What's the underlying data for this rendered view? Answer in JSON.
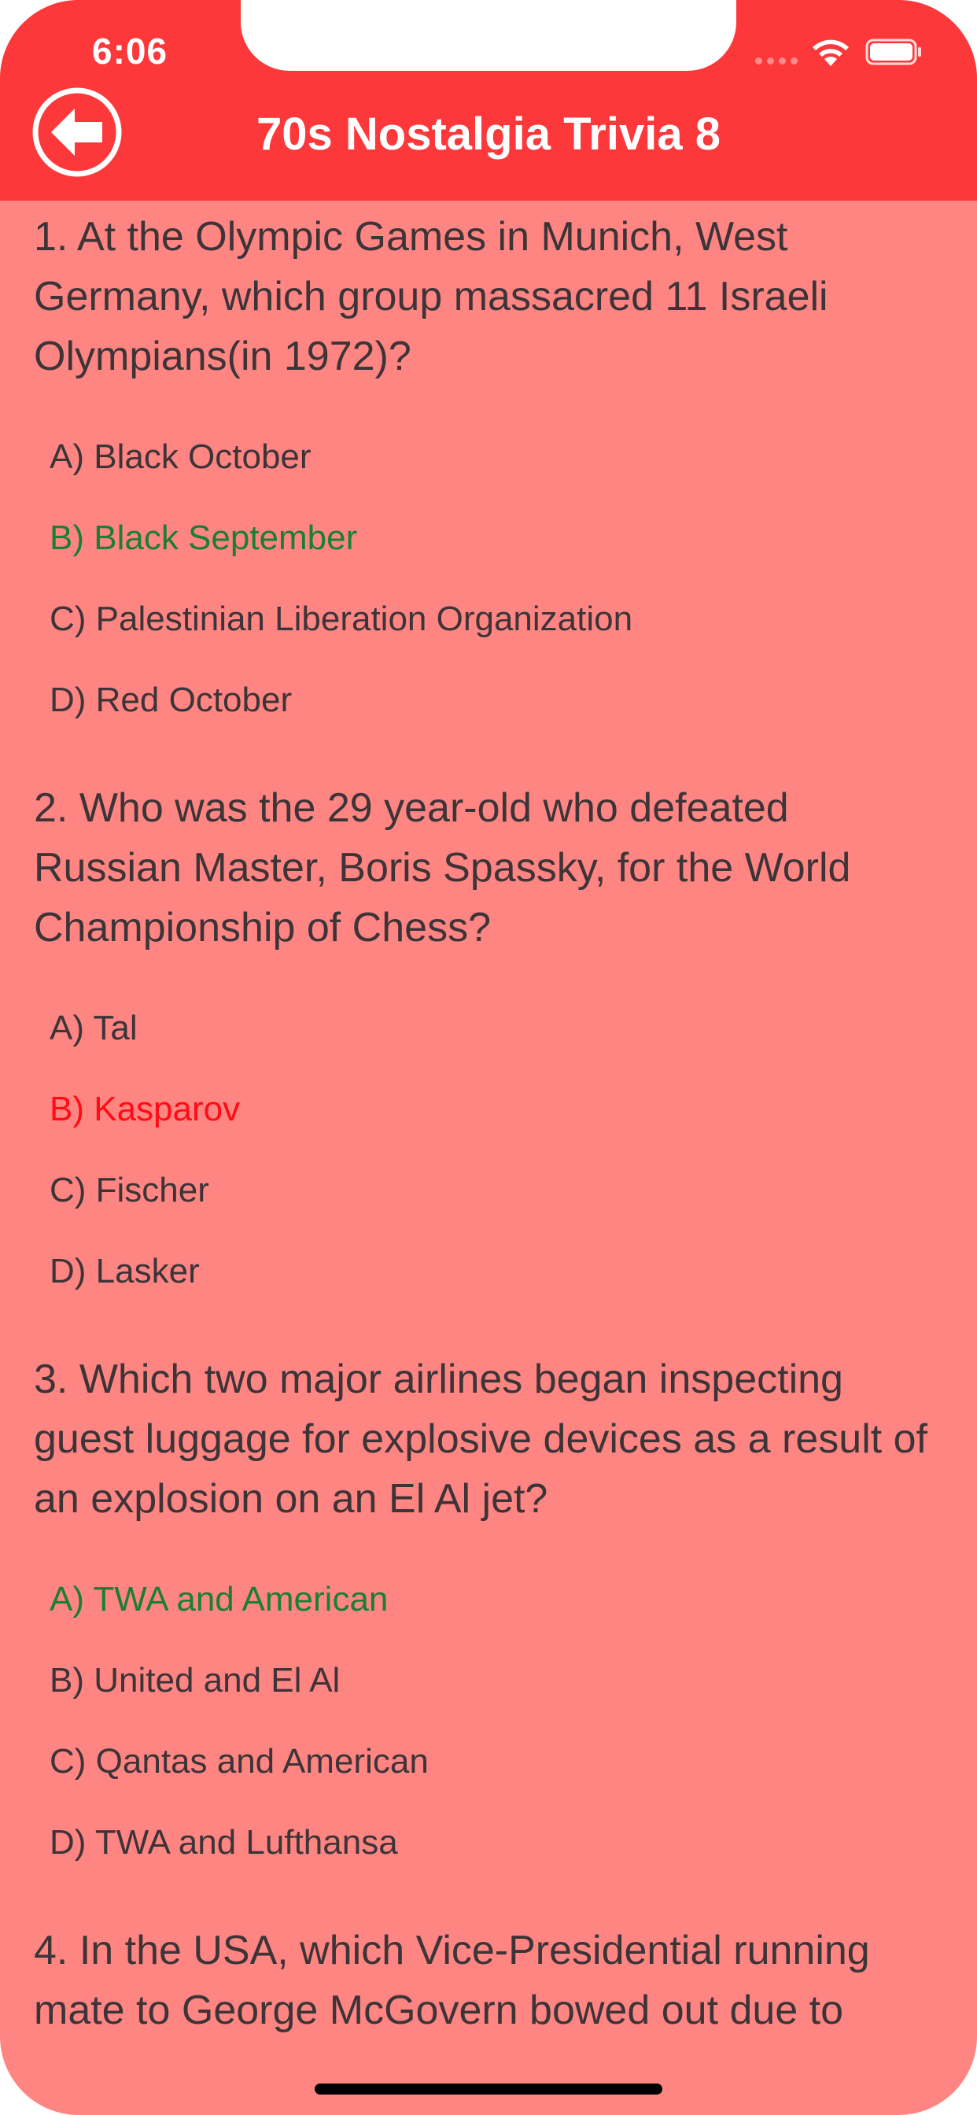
{
  "status_bar": {
    "time": "6:06"
  },
  "nav": {
    "title": "70s Nostalgia Trivia 8",
    "back_icon": "arrow-left-circle-icon"
  },
  "colors": {
    "nav_background": "#fd383b",
    "page_background": "#ff8583",
    "text": "#3c3437",
    "correct": "#1a7e36",
    "wrong": "#ff0c14"
  },
  "questions": [
    {
      "text": "1. At the Olympic Games in Munich, West Germany, which group massacred 11 Israeli Olympians(in 1972)?",
      "options": [
        {
          "label": "A) Black October",
          "state": "normal"
        },
        {
          "label": "B) Black September",
          "state": "correct"
        },
        {
          "label": "C) Palestinian Liberation Organization",
          "state": "normal"
        },
        {
          "label": "D) Red October",
          "state": "normal"
        }
      ]
    },
    {
      "text": "2. Who was the 29 year-old who defeated Russian Master, Boris Spassky, for the World Championship of Chess?",
      "options": [
        {
          "label": "A) Tal",
          "state": "normal"
        },
        {
          "label": "B) Kasparov",
          "state": "wrong"
        },
        {
          "label": "C) Fischer",
          "state": "normal"
        },
        {
          "label": "D) Lasker",
          "state": "normal"
        }
      ]
    },
    {
      "text": "3. Which two major airlines began inspecting guest luggage for explosive devices as a result of an explosion on an El Al jet?",
      "options": [
        {
          "label": "A) TWA and American",
          "state": "correct"
        },
        {
          "label": "B) United and El Al",
          "state": "normal"
        },
        {
          "label": "C) Qantas and American",
          "state": "normal"
        },
        {
          "label": "D) TWA and Lufthansa",
          "state": "normal"
        }
      ]
    },
    {
      "text": "4. In the USA, which Vice-Presidential running mate to George McGovern bowed out due to",
      "options": []
    }
  ]
}
